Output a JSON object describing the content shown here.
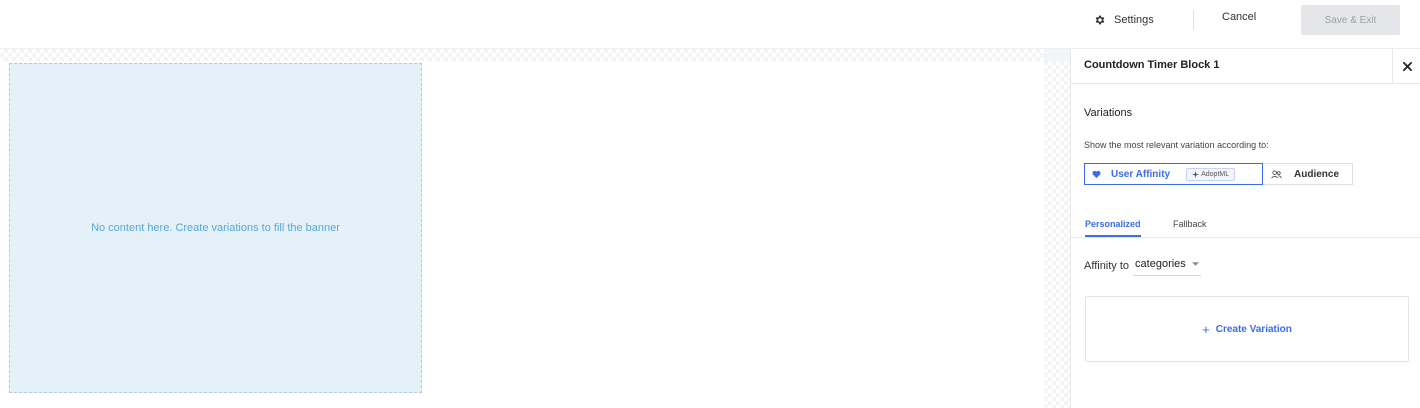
{
  "toolbar": {
    "settings_label": "Settings",
    "cancel_label": "Cancel",
    "save_exit_label": "Save & Exit"
  },
  "canvas": {
    "empty_message": "No content here. Create variations to fill the banner"
  },
  "panel": {
    "title": "Countdown Timer Block 1",
    "variations_title": "Variations",
    "variations_description": "Show the most relevant variation according to:",
    "mode_options": [
      {
        "label": "User Affinity",
        "badge": "AdoptML",
        "selected": true
      },
      {
        "label": "Audience",
        "selected": false
      }
    ],
    "tabs": [
      {
        "label": "Personalized",
        "active": true
      },
      {
        "label": "Fallback",
        "active": false
      }
    ],
    "affinity_label": "Affinity to",
    "affinity_value": "categories",
    "create_variation_label": "Create Variation"
  },
  "colors": {
    "accent": "#3d6bf0",
    "banner_fill": "#e4f1f9",
    "banner_text": "#5aa7d8",
    "disabled_button": "#e4e6e9"
  },
  "icons": {
    "settings": "gear-icon",
    "close": "close-icon",
    "affinity": "heart-icon",
    "audience": "users-icon",
    "dropdown": "chevron-down-icon",
    "create": "plus-icon"
  }
}
